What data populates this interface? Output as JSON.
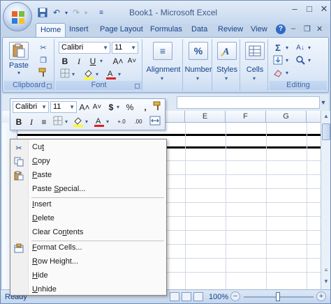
{
  "titlebar": {
    "title": "Book1 - Microsoft Excel"
  },
  "tabs": [
    {
      "label": "Home",
      "active": true
    },
    {
      "label": "Insert"
    },
    {
      "label": "Page Layout"
    },
    {
      "label": "Formulas"
    },
    {
      "label": "Data"
    },
    {
      "label": "Review"
    },
    {
      "label": "View"
    }
  ],
  "ribbon": {
    "clipboard": {
      "label": "Clipboard",
      "paste": "Paste"
    },
    "font": {
      "label": "Font",
      "name": "Calibri",
      "size": "11"
    },
    "alignment": {
      "label": "Alignment"
    },
    "number": {
      "label": "Number"
    },
    "styles": {
      "label": "Styles"
    },
    "cells": {
      "label": "Cells"
    },
    "editing": {
      "label": "Editing"
    }
  },
  "minitoolbar": {
    "font": "Calibri",
    "size": "11"
  },
  "columns": [
    "E",
    "F",
    "G"
  ],
  "contextmenu": {
    "items": [
      {
        "label": "Cut",
        "icon": "scissors-icon",
        "accel": "t",
        "pre": "Cu",
        "post": ""
      },
      {
        "label": "Copy",
        "icon": "copy-icon",
        "accel": "C",
        "pre": "",
        "post": "opy"
      },
      {
        "label": "Paste",
        "icon": "paste-icon",
        "accel": "P",
        "pre": "",
        "post": "aste"
      },
      {
        "label": "Paste Special...",
        "pre": "Paste ",
        "accel": "S",
        "post": "pecial..."
      },
      {
        "label": "Insert",
        "pre": "",
        "accel": "I",
        "post": "nsert"
      },
      {
        "label": "Delete",
        "pre": "",
        "accel": "D",
        "post": "elete"
      },
      {
        "label": "Clear Contents",
        "pre": "Clear Co",
        "accel": "n",
        "post": "tents"
      },
      {
        "label": "Format Cells...",
        "icon": "format-cells-icon",
        "pre": "",
        "accel": "F",
        "post": "ormat Cells..."
      },
      {
        "label": "Row Height...",
        "pre": "",
        "accel": "R",
        "post": "ow Height..."
      },
      {
        "label": "Hide",
        "pre": "",
        "accel": "H",
        "post": "ide"
      },
      {
        "label": "Unhide",
        "pre": "",
        "accel": "U",
        "post": "nhide"
      }
    ]
  },
  "statusbar": {
    "status": "Ready",
    "zoom": "100%",
    "zoom_level_percent": 100
  },
  "colors": {
    "ribbon_text": "#15428b",
    "frame": "#c4d5ea",
    "font_color_red": "#e02020",
    "highlight_yellow": "#ffff00"
  }
}
